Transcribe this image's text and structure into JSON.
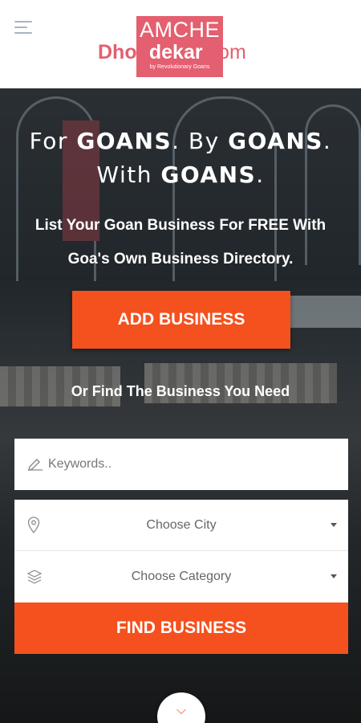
{
  "header": {
    "menu_icon": "hamburger-menu-icon",
    "logo": {
      "line1": "AMCHE",
      "dhon": "Dhon",
      "dekar": "dekar",
      "com": ".com",
      "sub": "by Revolutionary Goans"
    }
  },
  "hero": {
    "tagline_1a": "For ",
    "tagline_1b": "GOANS",
    "tagline_1c": ". By ",
    "tagline_1d": "GOANS",
    "tagline_1e": ".",
    "tagline_2a": "With ",
    "tagline_2b": "GOANS",
    "tagline_2c": ".",
    "subline_1": "List Your Goan Business For FREE With",
    "subline_2": "Goa's Own Business Directory.",
    "add_button": "ADD BUSINESS",
    "or_find": "Or Find The Business You Need"
  },
  "search": {
    "keyword_placeholder": "Keywords..",
    "keyword_icon": "pencil-icon",
    "city_label": "Choose City",
    "city_icon": "location-pin-icon",
    "category_label": "Choose Category",
    "category_icon": "layers-icon",
    "find_button": "FIND BUSINESS"
  },
  "colors": {
    "accent": "#f4511e",
    "brand": "#e45f6f"
  }
}
